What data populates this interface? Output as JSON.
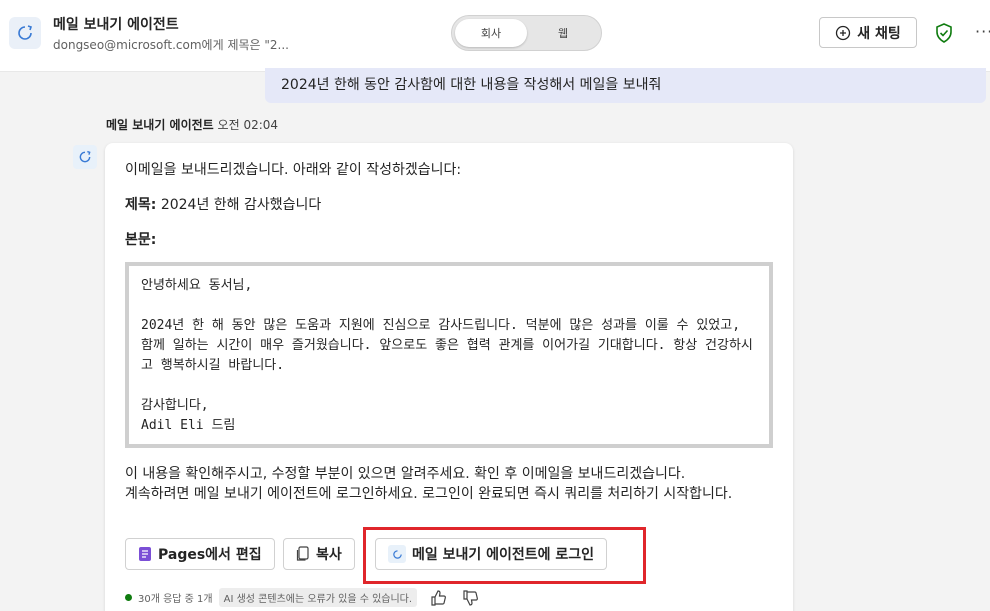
{
  "header": {
    "title": "메일 보내기 에이전트",
    "subtitle": "dongseo@microsoft.com에게 제목은 \"2...",
    "toggle": {
      "option1": "회사",
      "option2": "웹"
    },
    "new_chat_label": "새 채팅",
    "more_label": "···"
  },
  "user_message": "2024년 한해 동안 감사함에 대한 내용을 작성해서 메일을 보내줘",
  "bot": {
    "name": "메일 보내기 에이전트",
    "time": "오전 02:04",
    "intro": "이메일을 보내드리겠습니다. 아래와 같이 작성하겠습니다:",
    "subject_label": "제목:",
    "subject_value": "2024년 한해 감사했습니다",
    "body_label": "본문:",
    "email": {
      "greeting": "안녕하세요 동서님,",
      "para1": "2024년 한 해 동안 많은 도움과 지원에 진심으로 감사드립니다. 덕분에 많은 성과를 이룰 수 있었고, 함께 일하는 시간이 매우 즐거웠습니다. 앞으로도 좋은 협력 관계를 이어가길 기대합니다. 항상 건강하시고 행복하시길 바랍니다.",
      "closing": "감사합니다,",
      "signature": "Adil Eli 드림"
    },
    "confirm_text": "이 내용을 확인해주시고, 수정할 부분이 있으면 알려주세요. 확인 후 이메일을 보내드리겠습니다.",
    "login_text": "계속하려면 메일 보내기 에이전트에 로그인하세요. 로그인이 완료되면 즉시 쿼리를 처리하기 시작합니다.",
    "buttons": {
      "pages_edit": "Pages에서 편집",
      "copy": "복사",
      "login": "메일 보내기 에이전트에 로그인"
    },
    "footer": {
      "responses": "30개 응답 중 1개",
      "ai_notice": "AI 생성 콘텐츠에는 오류가 있을 수 있습니다."
    }
  },
  "colors": {
    "highlight": "#e0262b",
    "user_bubble": "#e5e8f8",
    "status_green": "#107c10",
    "pages_purple": "#7b4fd6"
  }
}
